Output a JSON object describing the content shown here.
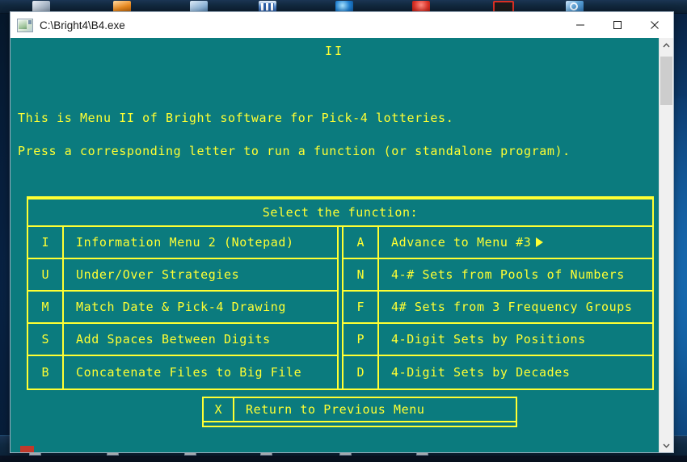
{
  "window": {
    "title": "C:\\Bright4\\B4.exe",
    "icon": "app-window-icon",
    "minimize_label": "Minimize",
    "maximize_label": "Maximize",
    "close_label": "Close"
  },
  "console": {
    "heading": "II",
    "line1": "This is Menu II of Bright software for Pick-4 lotteries.",
    "line2": "Press a corresponding letter to run a function (or standalone program).",
    "menu_header": "Select the function:",
    "left_column": [
      {
        "key": "I",
        "label": "Information Menu 2 (Notepad)"
      },
      {
        "key": "U",
        "label": "Under/Over Strategies"
      },
      {
        "key": "M",
        "label": "Match Date & Pick-4 Drawing"
      },
      {
        "key": "S",
        "label": "Add Spaces Between Digits"
      },
      {
        "key": "B",
        "label": "Concatenate Files to Big File"
      }
    ],
    "right_column": [
      {
        "key": "A",
        "label": "Advance to Menu #3",
        "arrow": true
      },
      {
        "key": "N",
        "label": "4-# Sets from Pools of Numbers",
        "arrow": false
      },
      {
        "key": "F",
        "label": "4# Sets from 3 Frequency Groups",
        "arrow": false
      },
      {
        "key": "P",
        "label": "4-Digit Sets by Positions",
        "arrow": false
      },
      {
        "key": "D",
        "label": "4-Digit Sets by Decades",
        "arrow": false
      }
    ],
    "return_row": {
      "key": "X",
      "label": "Return to Previous Menu"
    }
  },
  "scrollbar": {
    "up_label": "Scroll up",
    "down_label": "Scroll down",
    "thumb_label": "Scroll thumb"
  },
  "colors": {
    "console_background": "#0b7b7e",
    "console_foreground": "#ffff33",
    "titlebar_background": "#ffffff",
    "cursor": "#c0392b",
    "scrollbar_track": "#f0f0f0",
    "scrollbar_thumb": "#cdcdcd"
  }
}
